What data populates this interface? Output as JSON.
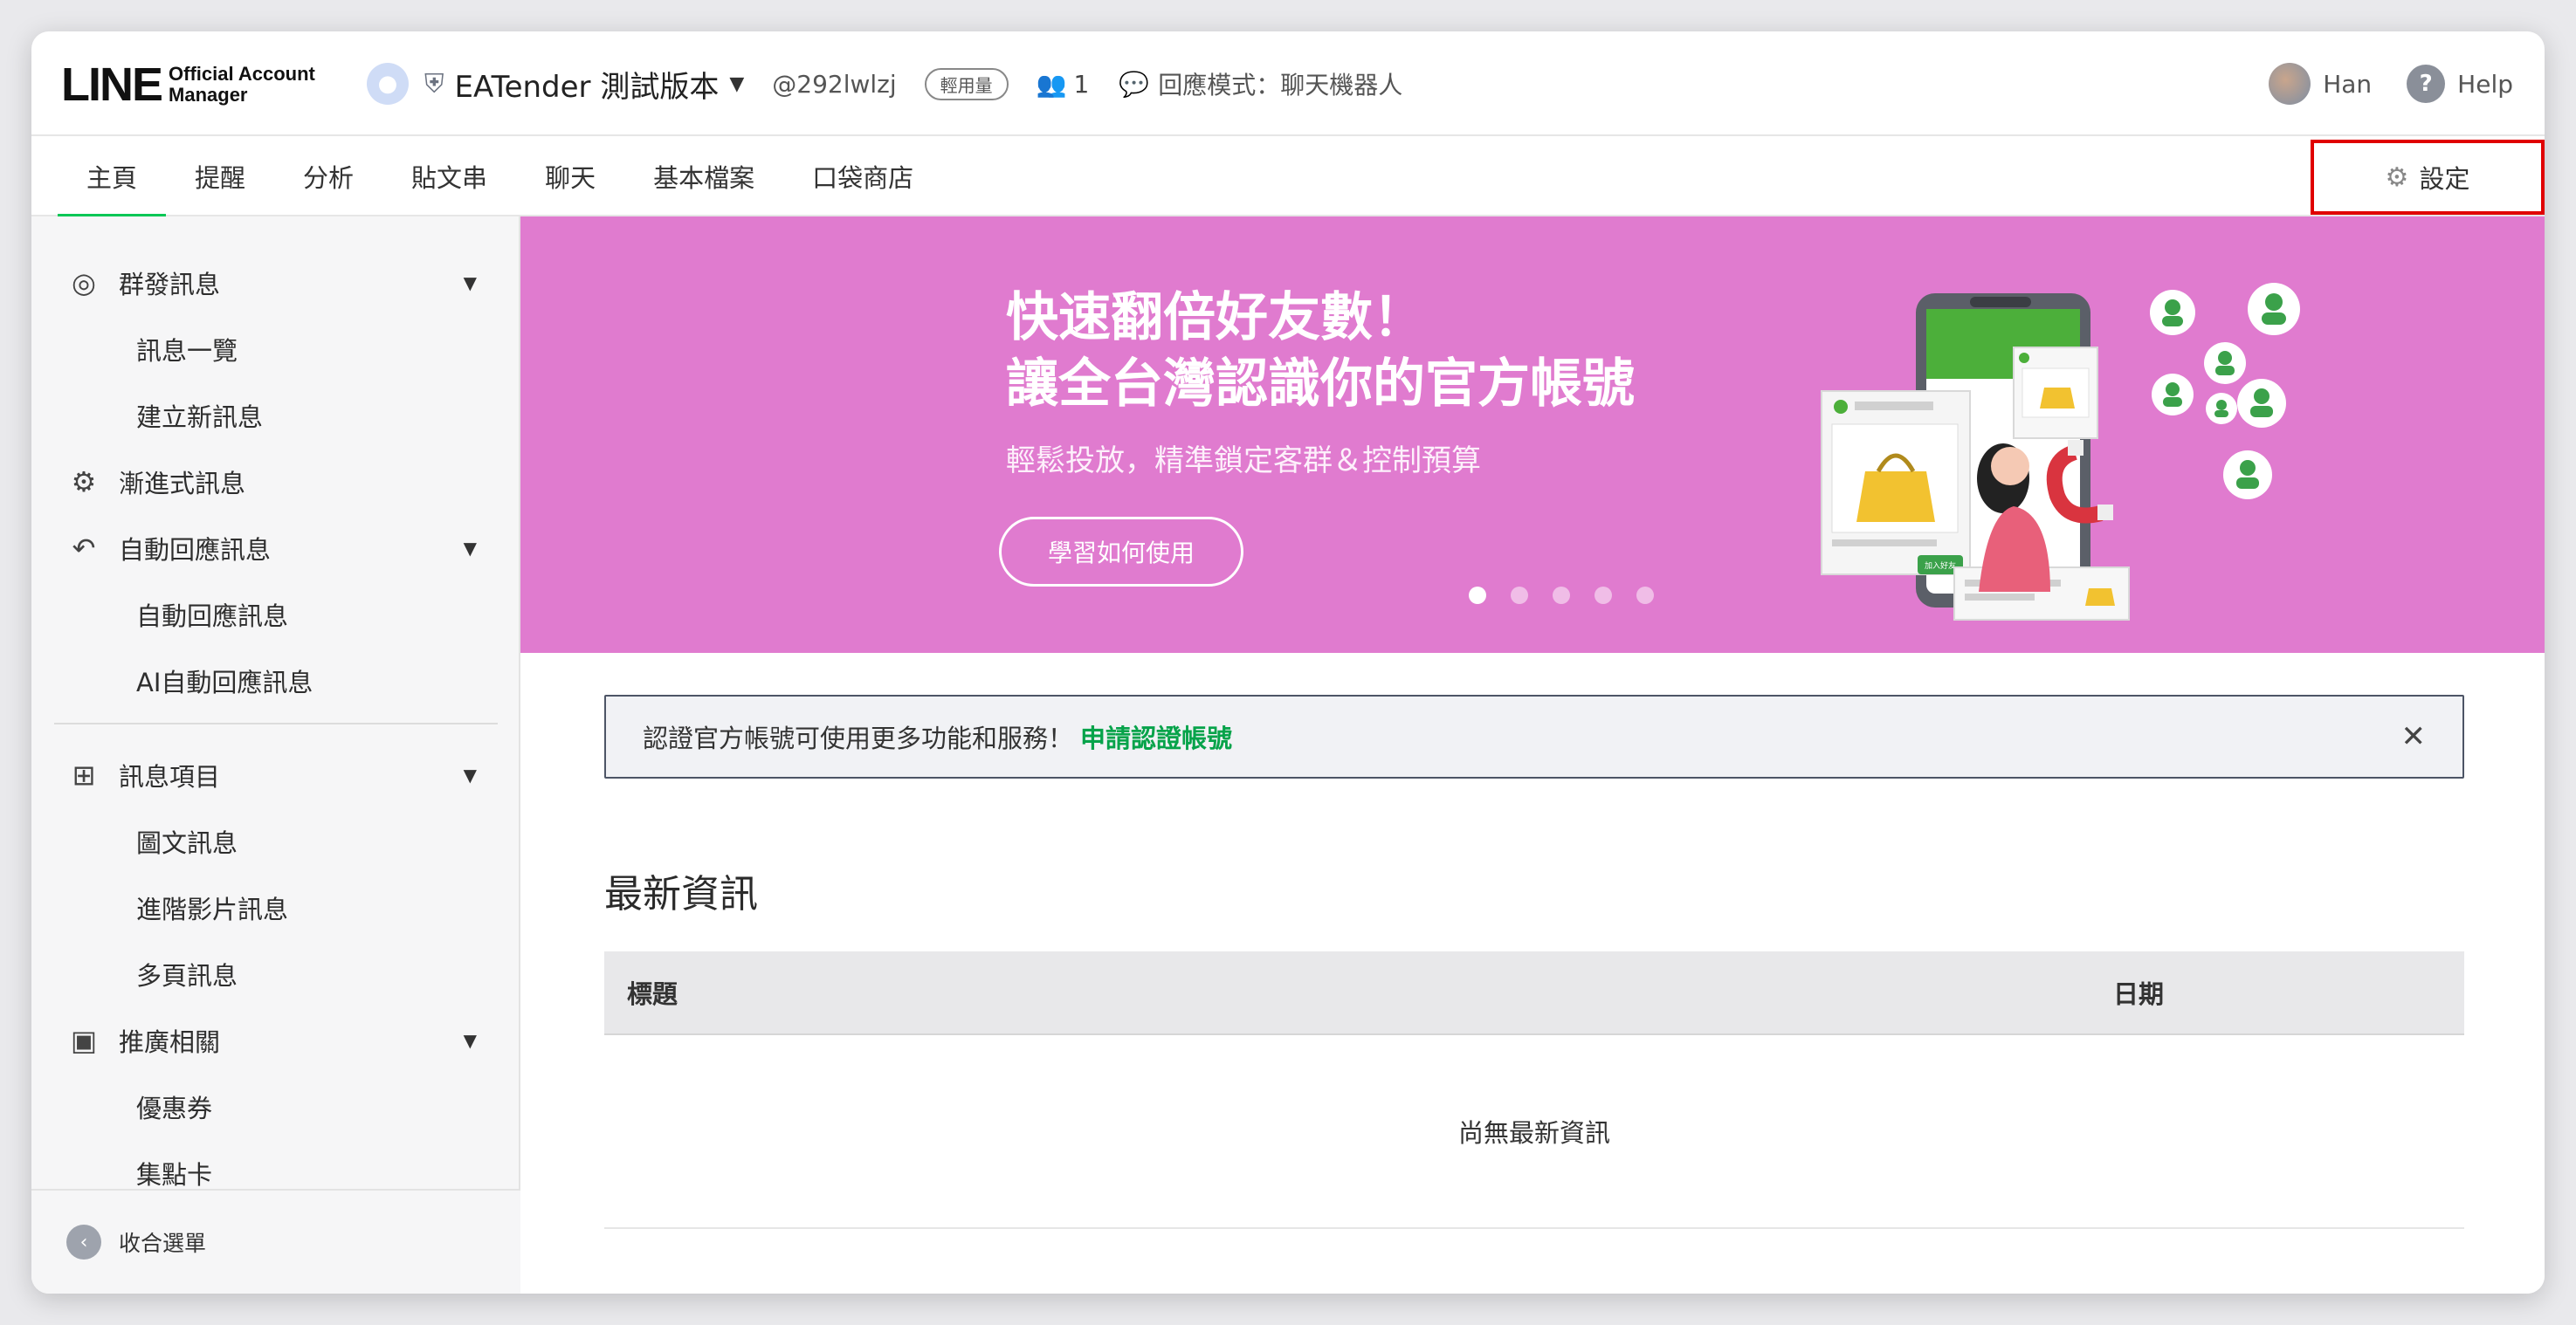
{
  "header": {
    "logo_line": "LINE",
    "logo_sub_1": "Official Account",
    "logo_sub_2": "Manager",
    "account_name": "EATender 測試版本",
    "account_id": "@292lwlzj",
    "plan_badge": "輕用量",
    "friends_count": "1",
    "response_mode": "回應模式：聊天機器人",
    "user_name": "Han",
    "help_label": "Help"
  },
  "nav": {
    "tabs": [
      "主頁",
      "提醒",
      "分析",
      "貼文串",
      "聊天",
      "基本檔案",
      "口袋商店"
    ],
    "active_tab": "主頁",
    "settings_label": "設定"
  },
  "sidebar": {
    "broadcast": "群發訊息",
    "broadcast_list": "訊息一覽",
    "broadcast_new": "建立新訊息",
    "step_messages": "漸進式訊息",
    "auto_reply": "自動回應訊息",
    "auto_reply_sub": "自動回應訊息",
    "ai_auto_reply": "AI自動回應訊息",
    "message_items": "訊息項目",
    "rich_message": "圖文訊息",
    "rich_video": "進階影片訊息",
    "card_message": "多頁訊息",
    "promotion": "推廣相關",
    "coupon": "優惠券",
    "reward_card": "集點卡",
    "collapse": "收合選單"
  },
  "banner": {
    "title_1": "快速翻倍好友數！",
    "title_2": "讓全台灣認識你的官方帳號",
    "subtitle": "輕鬆投放，精準鎖定客群＆控制預算",
    "button": "學習如何使用",
    "art_button": "加入好友",
    "dots_total": 5,
    "active_dot": 0,
    "bg_color": "#e07bcf"
  },
  "notice": {
    "text": "認證官方帳號可使用更多功能和服務！",
    "link": "申請認證帳號"
  },
  "news": {
    "title": "最新資訊",
    "col_title": "標題",
    "col_date": "日期",
    "empty": "尚無最新資訊"
  },
  "colors": {
    "accent": "#06c755",
    "highlight_box": "#e00000"
  }
}
